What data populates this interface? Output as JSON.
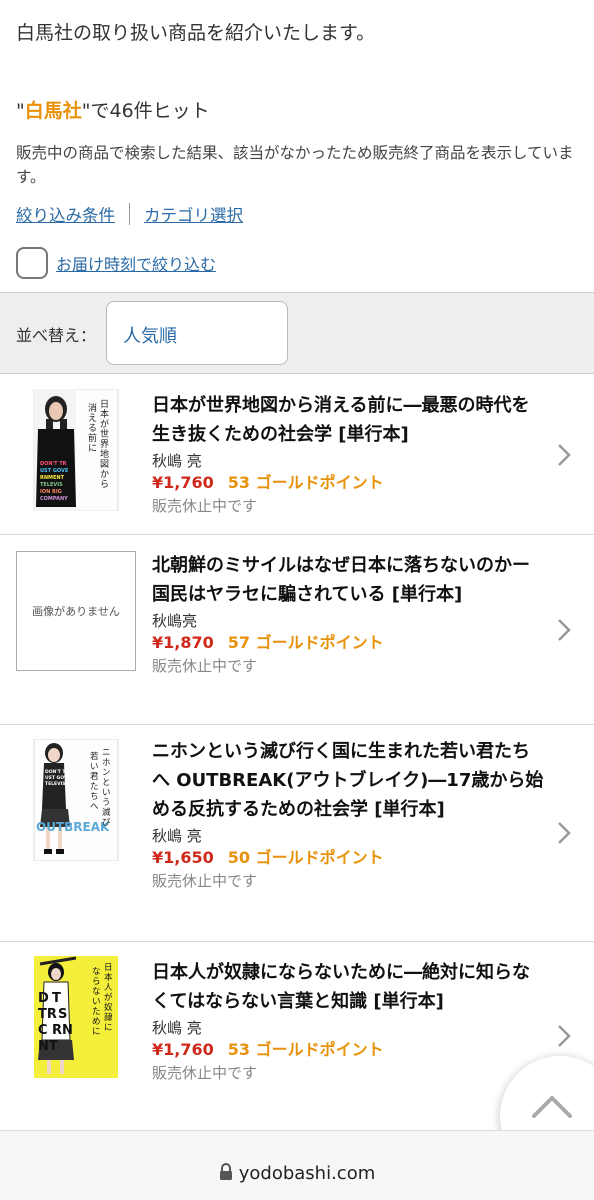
{
  "intro_text": "白馬社の取り扱い商品を紹介いたします。",
  "search_result": {
    "quote_open": "\"",
    "keyword": "白馬社",
    "suffix": "\"で46件ヒット"
  },
  "notice_text": "販売中の商品で検索した結果、該当がなかったため販売終了商品を表示しています。",
  "filters": {
    "filter_conditions": "絞り込み条件",
    "category_select": "カテゴリ選択"
  },
  "delivery_filter_label": "お届け時刻で絞り込む",
  "sort": {
    "label": "並べ替え：",
    "selected": "人気順"
  },
  "products": [
    {
      "title": "日本が世界地図から消える前に―最悪の時代を生き抜くための社会学 [単行本]",
      "author": "秋嶋 亮",
      "price": "¥1,760",
      "points": "53 ゴールドポイント",
      "status": "販売休止中です"
    },
    {
      "title": "北朝鮮のミサイルはなぜ日本に落ちないのかー国民はヤラセに騙されている [単行本]",
      "author": "秋嶋亮",
      "price": "¥1,870",
      "points": "57 ゴールドポイント",
      "status": "販売休止中です",
      "no_image_text": "画像がありません"
    },
    {
      "title": "ニホンという滅び行く国に生まれた若い君たちへ OUTBREAK(アウトブレイク)―17歳から始める反抗するための社会学 [単行本]",
      "author": "秋嶋 亮",
      "price": "¥1,650",
      "points": "50 ゴールドポイント",
      "status": "販売休止中です"
    },
    {
      "title": "日本人が奴隷にならないために―絶対に知らなくてはならない言葉と知識 [単行本]",
      "author": "秋嶋 亮",
      "price": "¥1,760",
      "points": "53 ゴールドポイント",
      "status": "販売休止中です"
    }
  ],
  "url": "yodobashi.com",
  "colors": {
    "link": "#2a6aa6",
    "keyword": "#e8920c",
    "price": "#d0281b",
    "points": "#e8920c"
  }
}
